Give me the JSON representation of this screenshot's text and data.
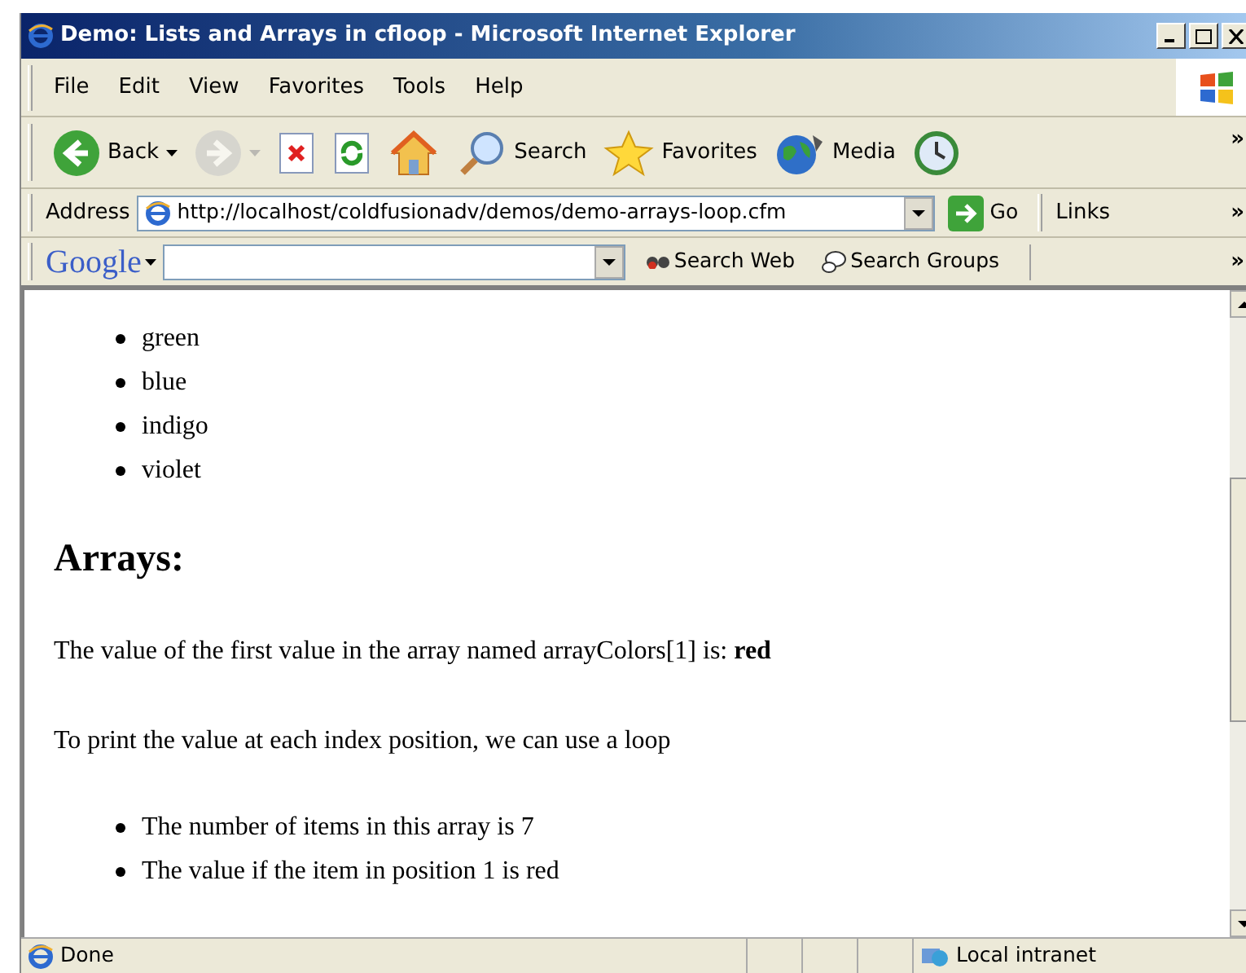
{
  "window": {
    "title": "Demo: Lists and Arrays in cfloop - Microsoft Internet Explorer"
  },
  "menu": [
    "File",
    "Edit",
    "View",
    "Favorites",
    "Tools",
    "Help"
  ],
  "toolbar": [
    {
      "kind": "back",
      "label": "Back",
      "disabled": false
    },
    {
      "kind": "forward",
      "disabled": true
    },
    {
      "kind": "stop",
      "disabled": false
    },
    {
      "kind": "refresh",
      "disabled": false
    },
    {
      "kind": "home",
      "disabled": false
    },
    {
      "kind": "search",
      "label": "Search",
      "disabled": false
    },
    {
      "kind": "favorites",
      "label": "Favorites",
      "disabled": false
    },
    {
      "kind": "media",
      "label": "Media",
      "disabled": false
    },
    {
      "kind": "history",
      "disabled": false
    }
  ],
  "overflow": "»",
  "address": {
    "label": "Address",
    "value": "http://localhost/coldfusionadv/demos/demo-arrays-loop.cfm",
    "go": "Go",
    "links": "Links"
  },
  "google": {
    "logo": "Google",
    "search_web": "Search Web",
    "search_groups": "Search Groups"
  },
  "content": {
    "list_1": [
      "green",
      "blue",
      "indigo",
      "violet"
    ],
    "heading": "Arrays:",
    "paragraphs": [
      "The value of the first value in the array named arrayColors[1] is: **red**",
      "To print the value at each index position, we can use a loop"
    ],
    "list_2": [
      "The number of items in this array is 7",
      "The value if the item in position 1 is red"
    ]
  },
  "status_bar": {
    "text": "Done",
    "zone": "Local intranet"
  }
}
